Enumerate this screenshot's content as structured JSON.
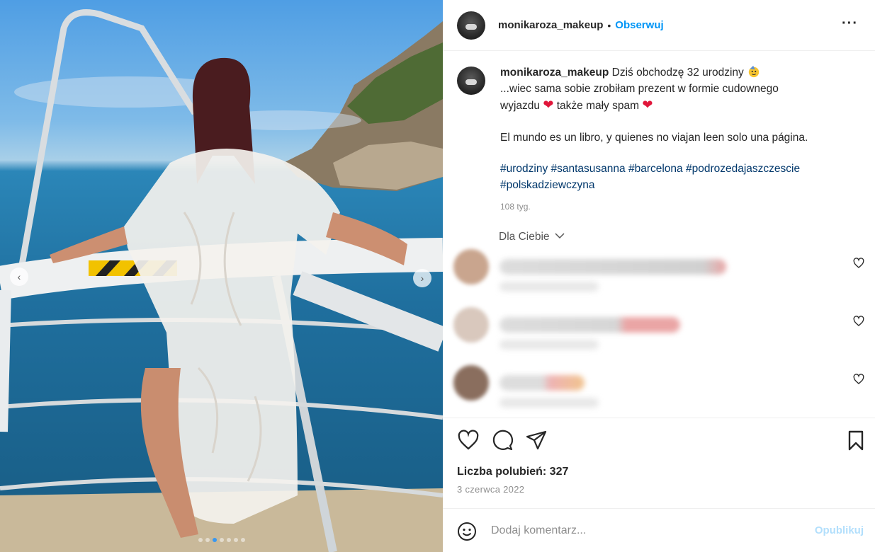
{
  "post": {
    "username": "monikaroza_makeup",
    "separator": "•",
    "follow_label": "Obserwuj",
    "more_icon": "more-options-icon",
    "caption": {
      "username": "monikaroza_makeup",
      "line1": "Dziś obchodzę 32 urodziny",
      "line2": "...wiec sama sobie zrobiłam prezent w formie cudownego",
      "line3_before": "wyjazdu",
      "line3_middle": "także mały spam",
      "quote": "El mundo es un libro, y quienes no viajan leen solo una página.",
      "tags_line1": "#urodziny #santasusanna #barcelona #podrozedajaszczescie",
      "tags_line2": "#polskadziewczyna",
      "time": "108 tyg."
    },
    "for_you_label": "Dla Ciebie",
    "likes_label": "Liczba polubień: 327",
    "date": "3 czerwca 2022",
    "comment_placeholder": "Dodaj komentarz...",
    "publish_label": "Opublikuj"
  },
  "colors": {
    "link_blue": "#0095f6",
    "hashtag": "#00376b",
    "muted": "#8e8e8e",
    "publish_disabled": "#b2dffc",
    "heart_red": "#e0163a"
  },
  "carousel": {
    "slide_count": 7,
    "active_index": 2
  }
}
